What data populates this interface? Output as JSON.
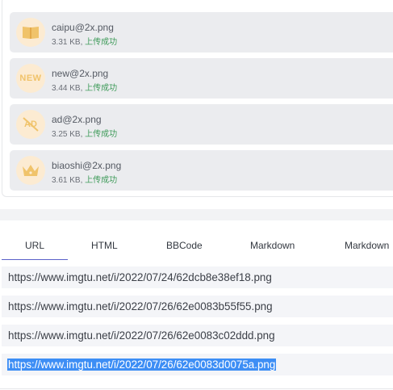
{
  "files": [
    {
      "name": "caipu@2x.png",
      "size": "3.31 KB,",
      "status": "上传成功",
      "icon": "book-icon"
    },
    {
      "name": "new@2x.png",
      "size": "3.44 KB,",
      "status": "上传成功",
      "icon": "new-badge-icon",
      "icon_text": "NEW"
    },
    {
      "name": "ad@2x.png",
      "size": "3.25 KB,",
      "status": "上传成功",
      "icon": "no-ad-icon",
      "icon_text": "AD"
    },
    {
      "name": "biaoshi@2x.png",
      "size": "3.61 KB,",
      "status": "上传成功",
      "icon": "crown-icon"
    }
  ],
  "tabs": [
    {
      "label": "URL",
      "active": true
    },
    {
      "label": "HTML",
      "active": false
    },
    {
      "label": "BBCode",
      "active": false
    },
    {
      "label": "Markdown",
      "active": false
    },
    {
      "label": "Markdown",
      "active": false
    }
  ],
  "links": [
    {
      "url": "https://www.imgtu.net/i/2022/07/24/62dcb8e38ef18.png",
      "selected": false
    },
    {
      "url": "https://www.imgtu.net/i/2022/07/26/62e0083b55f55.png",
      "selected": false
    },
    {
      "url": "https://www.imgtu.net/i/2022/07/26/62e0083c02ddd.png",
      "selected": false
    },
    {
      "url": "https://www.imgtu.net/i/2022/07/26/62e0083d0075a.png",
      "selected": true
    }
  ],
  "colors": {
    "accent": "#5b61c9",
    "success": "#3f9b5a",
    "selection": "#3d8ef5",
    "icon": "#f0c36a",
    "icon_bg": "#fcebd2"
  }
}
